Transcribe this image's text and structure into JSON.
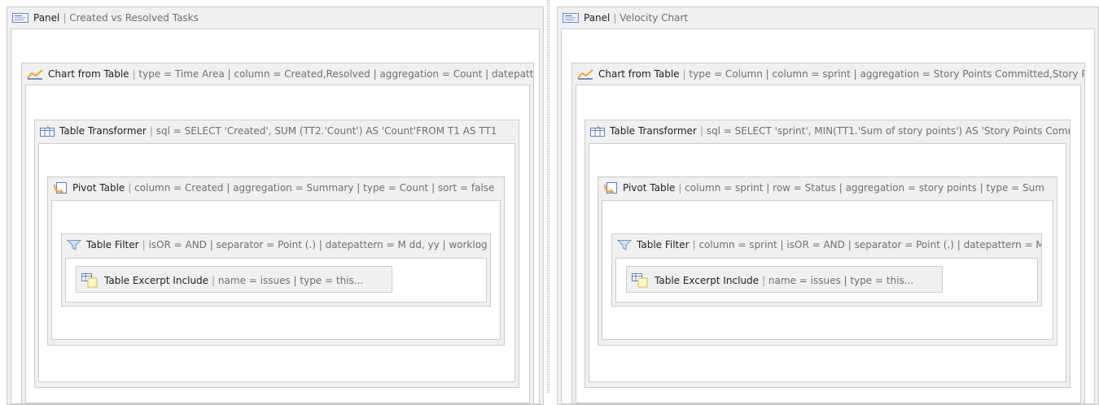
{
  "left": {
    "panel": {
      "title": "Panel",
      "params": "Created vs Resolved Tasks",
      "icon": "panel-icon"
    },
    "chart": {
      "title": "Chart from Table",
      "params": "type = Time Area | column = Created,Resolved | aggregation = Count | datepattern = M dd, yy",
      "icon": "chart-icon"
    },
    "transformer": {
      "title": "Table Transformer",
      "params": "sql = SELECT 'Created', SUM (TT2.'Count') AS 'Count'FROM T1 AS TT1",
      "icon": "table-transformer-icon"
    },
    "pivot": {
      "title": "Pivot Table",
      "params": "column = Created | aggregation = Summary | type = Count | sort = false",
      "icon": "pivot-table-icon"
    },
    "filter": {
      "title": "Table Filter",
      "params": "isOR = AND | separator = Point (.) | datepattern = M dd, yy | worklog",
      "icon": "funnel-icon"
    },
    "excerpt": {
      "title": "Table Excerpt Include",
      "params": "name = issues | type = this...",
      "icon": "table-excerpt-icon"
    }
  },
  "right": {
    "panel": {
      "title": "Panel",
      "params": "Velocity Chart",
      "icon": "panel-icon"
    },
    "chart": {
      "title": "Chart from Table",
      "params": "type = Column | column = sprint | aggregation = Story Points Committed,Story Points Completed",
      "icon": "chart-icon"
    },
    "transformer": {
      "title": "Table Transformer",
      "params": "sql = SELECT 'sprint', MIN(TT1.'Sum of story points') AS 'Story Points Committed'",
      "icon": "table-transformer-icon"
    },
    "pivot": {
      "title": "Pivot Table",
      "params": "column = sprint | row = Status | aggregation = story points | type = Sum",
      "icon": "pivot-table-icon"
    },
    "filter": {
      "title": "Table Filter",
      "params": "column = sprint | isOR = AND | separator = Point (.) | datepattern = M dd, yy",
      "icon": "funnel-icon"
    },
    "excerpt": {
      "title": "Table Excerpt Include",
      "params": "name = issues | type = this...",
      "icon": "table-excerpt-icon"
    }
  }
}
